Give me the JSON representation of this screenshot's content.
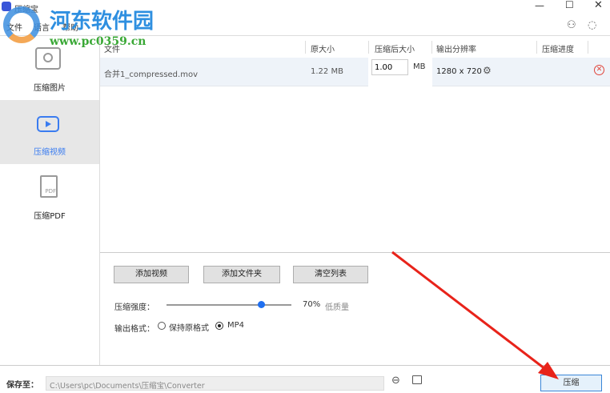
{
  "app": {
    "title": "压缩宝"
  },
  "menu": [
    "文件",
    "语言",
    "帮助"
  ],
  "watermark": {
    "name": "河东软件园",
    "url": "www.pc0359.cn"
  },
  "sidebar": [
    {
      "label": "压缩图片",
      "icon": "image-icon"
    },
    {
      "label": "压缩视频",
      "icon": "video-icon",
      "selected": true
    },
    {
      "label": "压缩PDF",
      "icon": "pdf-icon"
    }
  ],
  "table": {
    "headers": [
      "文件",
      "原大小",
      "压缩后大小",
      "输出分辨率",
      "压缩进度"
    ],
    "rows": [
      {
        "file": "合并1_compressed.mov",
        "size": "1.22 MB",
        "target": "1.00",
        "unit": "MB",
        "resolution": "1280 x 720",
        "progress": ""
      }
    ]
  },
  "actions": {
    "add_video": "添加视频",
    "add_folder": "添加文件夹",
    "clear": "清空列表"
  },
  "strength": {
    "label": "压缩强度：",
    "value": 70,
    "value_text": "70%",
    "quality": "低质量"
  },
  "format": {
    "label": "输出格式：",
    "options": [
      "保持原格式",
      "MP4"
    ],
    "selected": "MP4"
  },
  "save": {
    "label": "保存至：",
    "path": "C:\\Users\\pc\\Documents\\压缩宝\\Converter",
    "compress": "压缩"
  },
  "colors": {
    "accent": "#3a7cf0",
    "arrow": "#e8231a",
    "delete": "#e0443a"
  }
}
